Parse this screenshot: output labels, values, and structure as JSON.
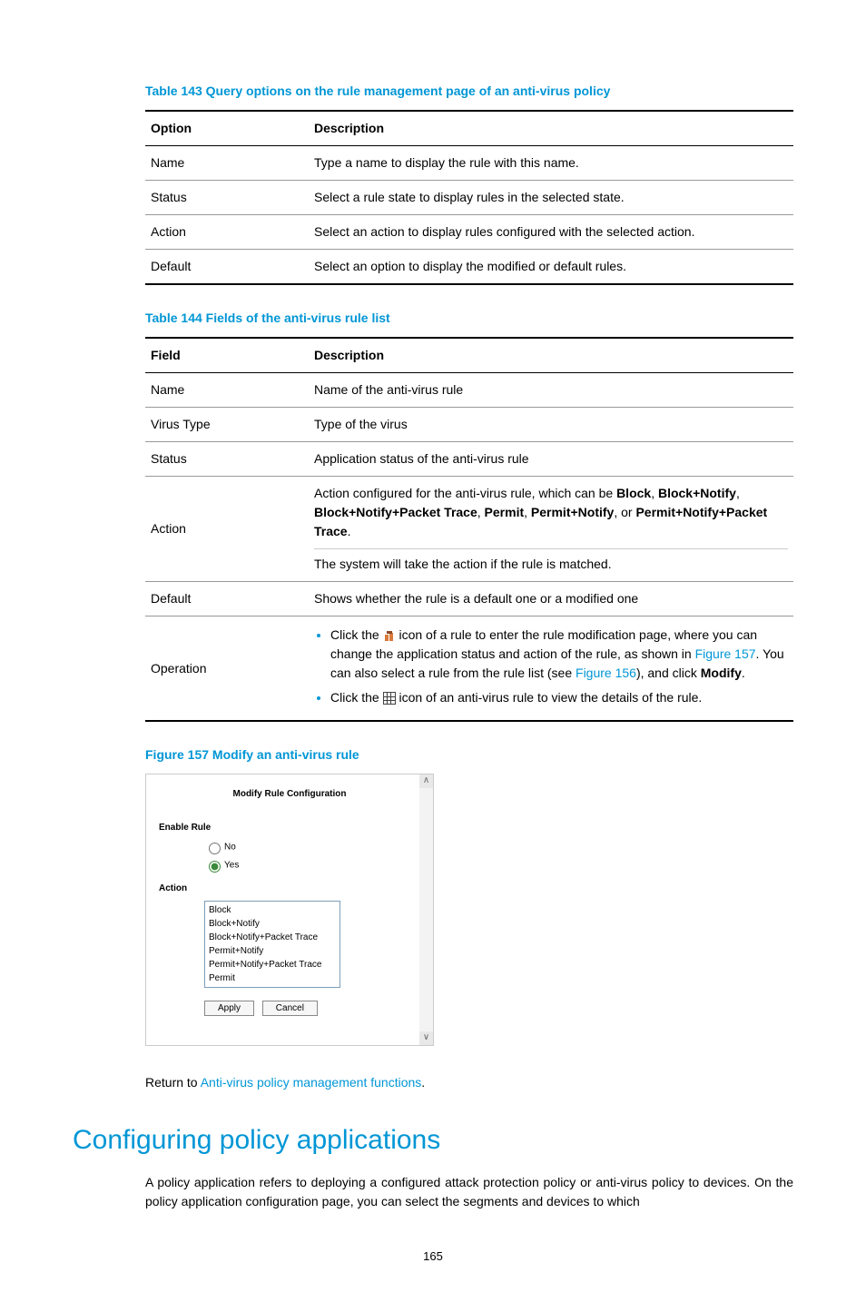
{
  "table143": {
    "caption": "Table 143 Query options on the rule management page of an anti-virus policy",
    "headers": [
      "Option",
      "Description"
    ],
    "rows": [
      [
        "Name",
        "Type a name to display the rule with this name."
      ],
      [
        "Status",
        "Select a rule state to display rules in the selected state."
      ],
      [
        "Action",
        "Select an action to display rules configured with the selected action."
      ],
      [
        "Default",
        "Select an option to display the modified or default rules."
      ]
    ]
  },
  "table144": {
    "caption": "Table 144 Fields of the anti-virus rule list",
    "headers": [
      "Field",
      "Description"
    ],
    "rows_simple": [
      [
        "Name",
        "Name of the anti-virus rule"
      ],
      [
        "Virus Type",
        "Type of the virus"
      ],
      [
        "Status",
        "Application status of the anti-virus rule"
      ]
    ],
    "action_row": {
      "field": "Action",
      "p1_pre": "Action configured for the anti-virus rule, which can be ",
      "p1_terms": [
        "Block",
        "Block+Notify",
        "Block+Notify+Packet Trace",
        "Permit",
        "Permit+Notify",
        "Permit+Notify+Packet Trace"
      ],
      "p1_sep1": ", ",
      "p1_sep_or": ", or ",
      "p1_post": ".",
      "p2": "The system will take the action if the rule is matched."
    },
    "default_row": [
      "Default",
      "Shows whether the rule is a default one or a modified one"
    ],
    "operation_row": {
      "field": "Operation",
      "b1_a": "Click the ",
      "b1_b": " icon of a rule to enter the rule modification page, where you can change the application status and action of the rule, as shown in ",
      "b1_fig157": "Figure 157",
      "b1_c": ". You can also select a rule from the rule list (see ",
      "b1_fig156": "Figure 156",
      "b1_d": "), and click ",
      "b1_modify": "Modify",
      "b1_e": ".",
      "b2_a": "Click the ",
      "b2_b": " icon of an anti-virus rule to view the details of the rule."
    }
  },
  "figure157": {
    "caption": "Figure 157 Modify an anti-virus rule",
    "panel_title": "Modify Rule Configuration",
    "enable_label": "Enable Rule",
    "radio_no": "No",
    "radio_yes": "Yes",
    "action_label": "Action",
    "options": [
      "Block",
      "Block+Notify",
      "Block+Notify+Packet Trace",
      "Permit+Notify",
      "Permit+Notify+Packet Trace",
      "Permit"
    ],
    "apply": "Apply",
    "cancel": "Cancel"
  },
  "return": {
    "pre": "Return to ",
    "link": "Anti-virus policy management functions",
    "post": "."
  },
  "section_heading": "Configuring policy applications",
  "body_p1": "A policy application refers to deploying a configured attack protection policy or anti-virus policy to devices. On the policy application configuration page, you can select the segments and devices to which",
  "page_number": "165",
  "chart_data": {
    "type": "table",
    "tables": [
      {
        "title": "Table 143 Query options on the rule management page of an anti-virus policy",
        "columns": [
          "Option",
          "Description"
        ],
        "rows": [
          [
            "Name",
            "Type a name to display the rule with this name."
          ],
          [
            "Status",
            "Select a rule state to display rules in the selected state."
          ],
          [
            "Action",
            "Select an action to display rules configured with the selected action."
          ],
          [
            "Default",
            "Select an option to display the modified or default rules."
          ]
        ]
      },
      {
        "title": "Table 144 Fields of the anti-virus rule list",
        "columns": [
          "Field",
          "Description"
        ],
        "rows": [
          [
            "Name",
            "Name of the anti-virus rule"
          ],
          [
            "Virus Type",
            "Type of the virus"
          ],
          [
            "Status",
            "Application status of the anti-virus rule"
          ],
          [
            "Action",
            "Action configured for the anti-virus rule, which can be Block, Block+Notify, Block+Notify+Packet Trace, Permit, Permit+Notify, or Permit+Notify+Packet Trace. The system will take the action if the rule is matched."
          ],
          [
            "Default",
            "Shows whether the rule is a default one or a modified one"
          ],
          [
            "Operation",
            "Click the modify icon of a rule to enter the rule modification page, where you can change the application status and action of the rule, as shown in Figure 157. You can also select a rule from the rule list (see Figure 156), and click Modify. Click the details icon of an anti-virus rule to view the details of the rule."
          ]
        ]
      }
    ]
  }
}
